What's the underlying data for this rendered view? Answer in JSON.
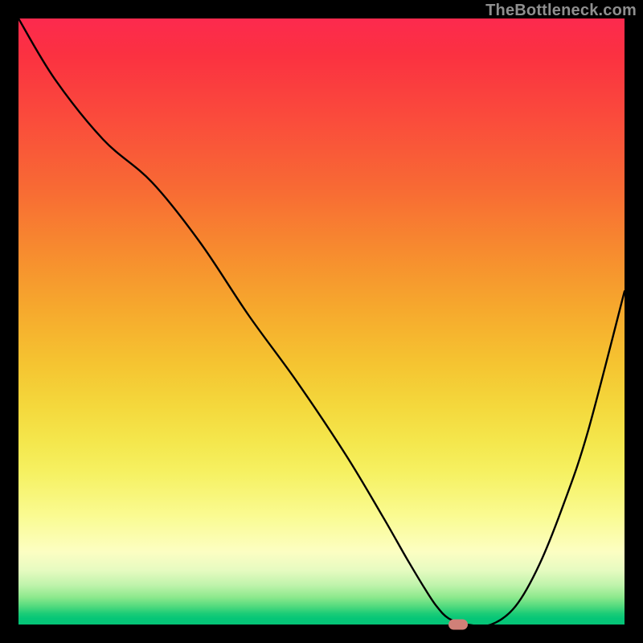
{
  "watermark": "TheBottleneck.com",
  "colors": {
    "frame": "#000000",
    "marker": "#d08078",
    "curve": "#000000"
  },
  "chart_data": {
    "type": "line",
    "title": "",
    "xlabel": "",
    "ylabel": "",
    "xlim": [
      0,
      100
    ],
    "ylim": [
      0,
      100
    ],
    "grid": false,
    "legend": false,
    "series": [
      {
        "name": "curve",
        "x": [
          0,
          6,
          14,
          22,
          30,
          38,
          46,
          54,
          60,
          64,
          67,
          69,
          71,
          74,
          78,
          82,
          86,
          90,
          94,
          100
        ],
        "y": [
          100,
          90,
          80,
          73,
          63,
          51,
          40,
          28,
          18,
          11,
          6,
          3,
          1,
          0,
          0,
          3,
          10,
          20,
          32,
          55
        ]
      }
    ],
    "marker": {
      "x": 72.5,
      "y": 0
    },
    "background_gradient_note": "vertical spectral red→yellow→green"
  }
}
